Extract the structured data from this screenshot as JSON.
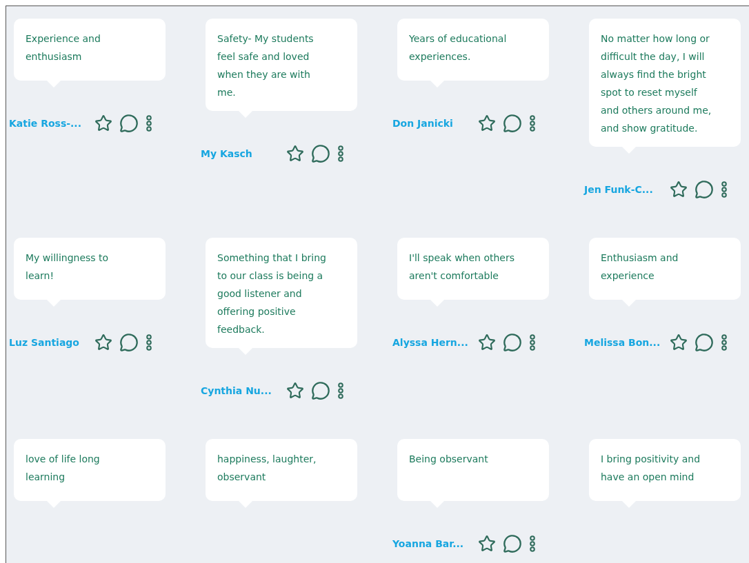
{
  "rows": [
    {
      "cards": [
        {
          "text": "Experience and enthusiasm",
          "author": "Katie Ross-..."
        },
        {
          "text": "Safety- My students feel safe and loved when they are with me.",
          "author": "My Kasch"
        },
        {
          "text": "Years of educational experiences.",
          "author": "Don Janicki"
        },
        {
          "text": "No matter how long or difficult the day, I will always find the bright spot to reset myself and others around me, and show gratitude.",
          "author": "Jen Funk-C..."
        }
      ]
    },
    {
      "cards": [
        {
          "text": "My willingness to learn!",
          "author": "Luz Santiago"
        },
        {
          "text": "Something that I bring to our class is being a good listener and offering positive feedback.",
          "author": "Cynthia Nu..."
        },
        {
          "text": "I'll speak when others aren't comfortable",
          "author": "Alyssa Hern..."
        },
        {
          "text": "Enthusiasm and experience",
          "author": "Melissa Bon..."
        }
      ]
    },
    {
      "cards": [
        {
          "text": "love of life long learning"
        },
        {
          "text": "happiness, laughter, observant"
        },
        {
          "text": "Being observant",
          "author": "Yoanna Bar..."
        },
        {
          "text": "I bring positivity and have an open mind"
        }
      ]
    }
  ]
}
